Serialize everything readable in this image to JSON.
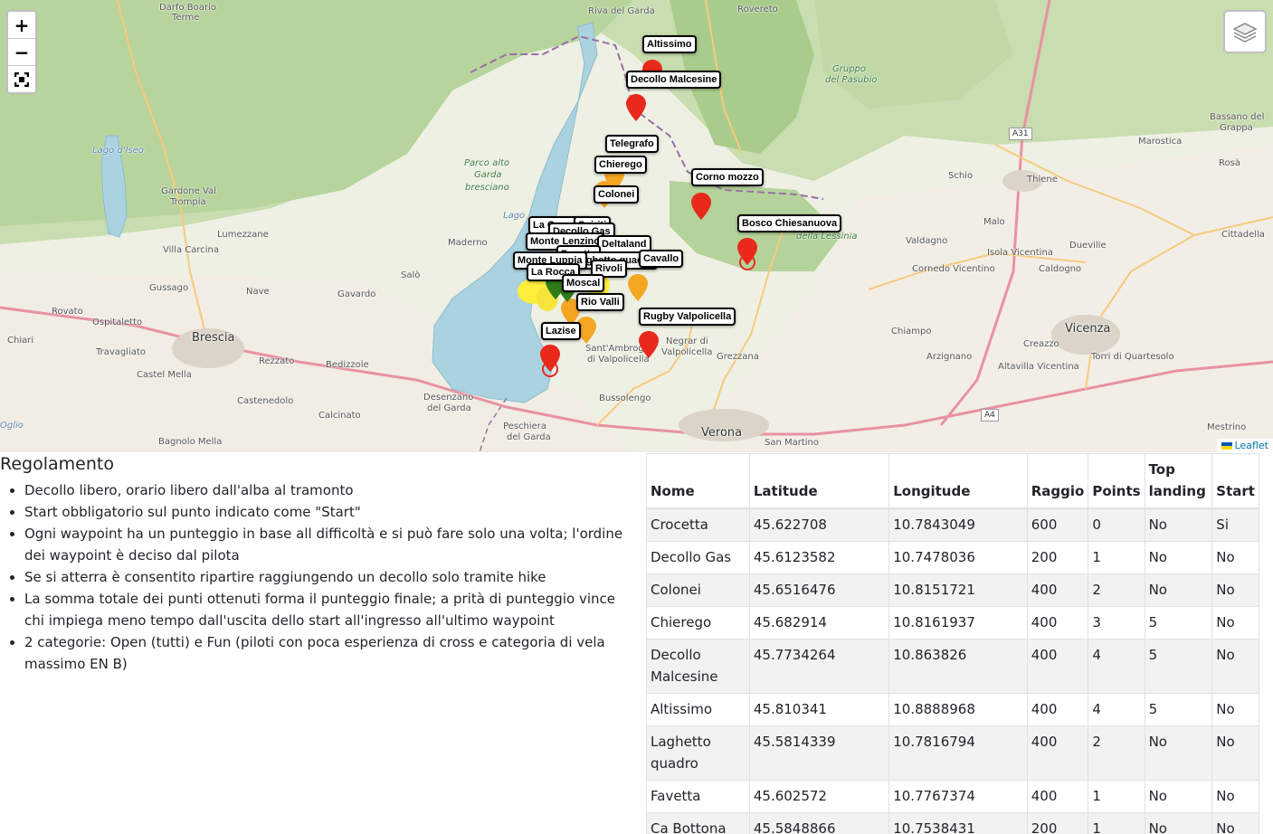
{
  "map": {
    "zoom_in": "+",
    "zoom_out": "−",
    "attribution": "Leaflet",
    "places": [
      {
        "text": "Darfo Boario",
        "cls": ""
      },
      {
        "text": "Terme",
        "cls": ""
      },
      {
        "text": "Riva del Garda",
        "cls": ""
      },
      {
        "text": "Rovereto",
        "cls": ""
      },
      {
        "text": "Gruppo",
        "cls": "green"
      },
      {
        "text": "del Pasubio",
        "cls": "green"
      },
      {
        "text": "Lago d'Iseo",
        "cls": "water"
      },
      {
        "text": "Parco alto",
        "cls": "green"
      },
      {
        "text": "Garda",
        "cls": "green"
      },
      {
        "text": "bresciano",
        "cls": "green"
      },
      {
        "text": "Gardone Val",
        "cls": ""
      },
      {
        "text": "Trompia",
        "cls": ""
      },
      {
        "text": "Villa Carcina",
        "cls": ""
      },
      {
        "text": "Lumezzane",
        "cls": ""
      },
      {
        "text": "Lago",
        "cls": "water"
      },
      {
        "text": "Maderno",
        "cls": ""
      },
      {
        "text": "Salò",
        "cls": ""
      },
      {
        "text": "Gussago",
        "cls": ""
      },
      {
        "text": "Nave",
        "cls": ""
      },
      {
        "text": "Gavardo",
        "cls": ""
      },
      {
        "text": "Rovato",
        "cls": ""
      },
      {
        "text": "Ospitaletto",
        "cls": ""
      },
      {
        "text": "Brescia",
        "cls": "city"
      },
      {
        "text": "Chiari",
        "cls": ""
      },
      {
        "text": "Travagliato",
        "cls": ""
      },
      {
        "text": "Rezzato",
        "cls": ""
      },
      {
        "text": "Bedizzole",
        "cls": ""
      },
      {
        "text": "Castel Mella",
        "cls": ""
      },
      {
        "text": "Castenedolo",
        "cls": ""
      },
      {
        "text": "Desenzano",
        "cls": ""
      },
      {
        "text": "del Garda",
        "cls": ""
      },
      {
        "text": "Calcinato",
        "cls": ""
      },
      {
        "text": "Oglio",
        "cls": "water"
      },
      {
        "text": "Bagnolo Mella",
        "cls": ""
      },
      {
        "text": "Peschiera",
        "cls": ""
      },
      {
        "text": "del Garda",
        "cls": ""
      },
      {
        "text": "Bussolengo",
        "cls": ""
      },
      {
        "text": "Verona",
        "cls": "city"
      },
      {
        "text": "San Martino",
        "cls": ""
      },
      {
        "text": "Sant'Ambrogio",
        "cls": ""
      },
      {
        "text": "di Valpolicella",
        "cls": ""
      },
      {
        "text": "Negrar di",
        "cls": ""
      },
      {
        "text": "Valpolicella",
        "cls": ""
      },
      {
        "text": "Grezzana",
        "cls": ""
      },
      {
        "text": "della Lessinia",
        "cls": "green"
      },
      {
        "text": "Schio",
        "cls": ""
      },
      {
        "text": "Thiene",
        "cls": ""
      },
      {
        "text": "Malo",
        "cls": ""
      },
      {
        "text": "Bassano del",
        "cls": ""
      },
      {
        "text": "Grappa",
        "cls": ""
      },
      {
        "text": "Marostica",
        "cls": ""
      },
      {
        "text": "Rosà",
        "cls": ""
      },
      {
        "text": "Valdagno",
        "cls": ""
      },
      {
        "text": "Isola Vicentina",
        "cls": ""
      },
      {
        "text": "Dueville",
        "cls": ""
      },
      {
        "text": "Cittadella",
        "cls": ""
      },
      {
        "text": "Cornedo Vicentino",
        "cls": ""
      },
      {
        "text": "Caldogno",
        "cls": ""
      },
      {
        "text": "Vicenza",
        "cls": "city"
      },
      {
        "text": "Chiampo",
        "cls": ""
      },
      {
        "text": "Creazzo",
        "cls": ""
      },
      {
        "text": "Arzignano",
        "cls": ""
      },
      {
        "text": "Altavilla Vicentina",
        "cls": ""
      },
      {
        "text": "Torri di Quartesolo",
        "cls": ""
      },
      {
        "text": "Mestrino",
        "cls": ""
      }
    ],
    "shields": [
      "A31",
      "A4"
    ],
    "labels": [
      "Altissimo",
      "Decollo Malcesine",
      "Telegrafo",
      "Chierego",
      "Corno mozzo",
      "Colonei",
      "Bosco Chiesanuova",
      "La Crocetta",
      "Spiriti",
      "Decollo Gas",
      "Monte Lenzino",
      "Deltaland",
      "Favetta",
      "Laghetto quadro",
      "Cavallo",
      "Monte Luppia",
      "La Rocca",
      "Rivoli",
      "Moscal",
      "Rio Valli",
      "Rugby Valpolicella",
      "Lazise"
    ],
    "pin_colors": {
      "red": "#e8291c",
      "orange": "#f5a623",
      "yellow": "#ffef3a",
      "green": "#2e7d1a"
    }
  },
  "rules": {
    "title": "Regolamento",
    "items": [
      "Decollo libero, orario libero dall'alba al tramonto",
      "Start obbligatorio sul punto indicato come \"Start\"",
      "Ogni waypoint ha un punteggio in base all difficoltà e si può fare solo una volta; l'ordine dei waypoint è deciso dal pilota",
      "Se si atterra è consentito ripartire raggiungendo un decollo solo tramite hike",
      "La somma totale dei punti ottenuti forma il punteggio finale; a prità di punteggio vince chi impiega meno tempo dall'uscita dello start all'ingresso all'ultimo waypoint",
      "2 categorie: Open (tutti) e Fun (piloti con poca esperienza di cross e categoria di vela massimo EN B)"
    ]
  },
  "table": {
    "headers": [
      "Nome",
      "Latitude",
      "Longitude",
      "Raggio",
      "Points",
      "Top landing",
      "Start"
    ],
    "rows": [
      [
        "Crocetta",
        "45.622708",
        "10.7843049",
        "600",
        "0",
        "No",
        "Si"
      ],
      [
        "Decollo Gas",
        "45.6123582",
        "10.7478036",
        "200",
        "1",
        "No",
        "No"
      ],
      [
        "Colonei",
        "45.6516476",
        "10.8151721",
        "400",
        "2",
        "No",
        "No"
      ],
      [
        "Chierego",
        "45.682914",
        "10.8161937",
        "400",
        "3",
        "5",
        "No"
      ],
      [
        "Decollo Malcesine",
        "45.7734264",
        "10.863826",
        "400",
        "4",
        "5",
        "No"
      ],
      [
        "Altissimo",
        "45.810341",
        "10.8888968",
        "400",
        "4",
        "5",
        "No"
      ],
      [
        "Laghetto quadro",
        "45.5814339",
        "10.7816794",
        "400",
        "2",
        "No",
        "No"
      ],
      [
        "Favetta",
        "45.602572",
        "10.7767374",
        "400",
        "1",
        "No",
        "No"
      ],
      [
        "Ca Bottona",
        "45.5848866",
        "10.7538431",
        "200",
        "1",
        "No",
        "No"
      ]
    ]
  }
}
